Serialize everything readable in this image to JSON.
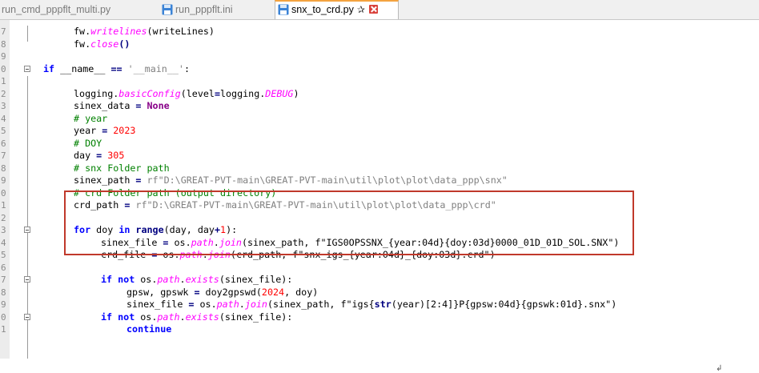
{
  "tabs": [
    {
      "label": "run_cmd_pppflt_multi.py",
      "icon": "python-file-icon",
      "active": false
    },
    {
      "label": "run_pppflt.ini",
      "icon": "save-file-icon",
      "active": false
    },
    {
      "label": "snx_to_crd.py",
      "icon": "save-file-icon",
      "active": true
    }
  ],
  "active_tab_pin": "✰",
  "eol_mark": "↲",
  "line_numbers": [
    "7",
    "8",
    "9",
    "0",
    "1",
    "2",
    "3",
    "4",
    "5",
    "6",
    "7",
    "8",
    "9",
    "0",
    "1",
    "2",
    "3",
    "4",
    "5",
    "6",
    "7",
    "8",
    "9",
    "0",
    "1"
  ],
  "code": {
    "l0a": "fw.",
    "l0b": "writelines",
    "l0c": "(writeLines)",
    "l1a": "fw.",
    "l1b": "close",
    "l1c": "()",
    "l3a": "if",
    "l3b": " __name__ ",
    "l3c": "==",
    "l3d": " '__main__'",
    "l3e": ":",
    "l5a": "logging.",
    "l5b": "basicConfig",
    "l5c": "(level",
    "l5d": "=",
    "l5e": "logging.",
    "l5f": "DEBUG",
    "l5g": ")",
    "l6a": "sinex_data ",
    "l6b": "=",
    "l6c": " None",
    "l7": "# year",
    "l8a": "year ",
    "l8b": "=",
    "l8c": " 2023",
    "l9": "# DOY",
    "l10a": "day ",
    "l10b": "=",
    "l10c": " 305",
    "l11": "# snx Folder path",
    "l12a": "sinex_path ",
    "l12b": "=",
    "l12c": " rf\"D:\\GREAT-PVT-main\\GREAT-PVT-main\\util\\plot\\plot\\data_ppp\\snx\"",
    "l13": "# crd Folder path (output directory)",
    "l14a": "crd_path ",
    "l14b": "=",
    "l14c": " rf\"D:\\GREAT-PVT-main\\GREAT-PVT-main\\util\\plot\\plot\\data_ppp\\crd\"",
    "l16a": "for",
    "l16b": " doy ",
    "l16c": "in",
    "l16d": " range",
    "l16e": "(day, day",
    "l16f": "+",
    "l16g": "1",
    "l16h": "):",
    "l17a": "sinex_file ",
    "l17b": "=",
    "l17c": " os.",
    "l17d": "path",
    "l17e": ".",
    "l17f": "join",
    "l17g": "(sinex_path, f\"IGS0OPSSNX_{year:04d}{doy:03d}0000_01D_01D_SOL.SNX\")",
    "l18a": "crd_file ",
    "l18b": "=",
    "l18c": " os.",
    "l18d": "path",
    "l18e": ".",
    "l18f": "join",
    "l18g": "(crd_path, f\"snx_igs_{year:04d}_{doy:03d}.crd\")",
    "l20a": "if",
    "l20b": " not",
    "l20c": " os.",
    "l20d": "path",
    "l20e": ".",
    "l20f": "exists",
    "l20g": "(sinex_file):",
    "l21a": "gpsw, gpswk ",
    "l21b": "=",
    "l21c": " doy2gpswd(",
    "l21d": "2024",
    "l21e": ", doy)",
    "l22a": "sinex_file ",
    "l22b": "=",
    "l22c": " os.",
    "l22d": "path",
    "l22e": ".",
    "l22f": "join",
    "l22g": "(sinex_path, f\"igs{",
    "l22h": "str",
    "l22i": "(year)[2:4]}P{gpsw:04d}{gpswk:01d}.snx\")",
    "l23a": "if",
    "l23b": " not",
    "l23c": " os.",
    "l23d": "path",
    "l23e": ".",
    "l23f": "exists",
    "l23g": "(sinex_file):",
    "l24": "continue"
  }
}
